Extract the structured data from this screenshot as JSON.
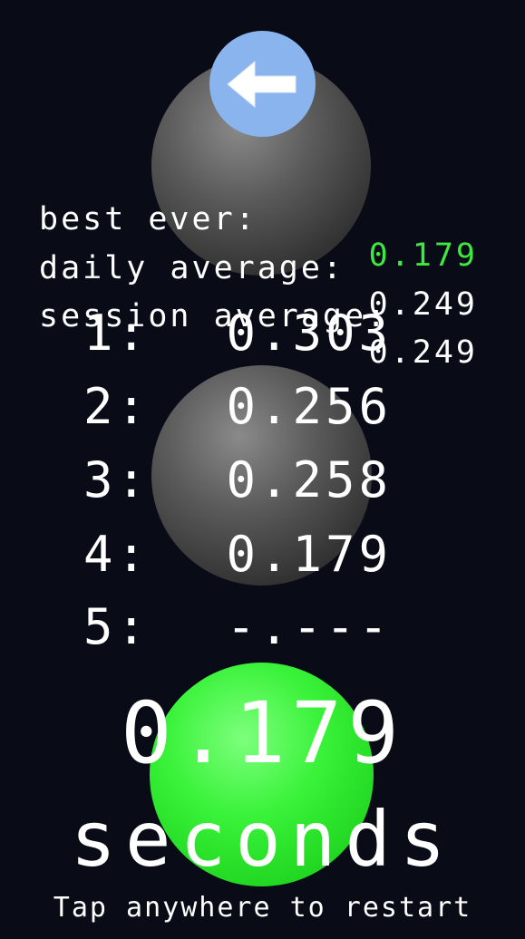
{
  "colors": {
    "background": "#090b16",
    "text": "#ffffff",
    "best_highlight": "#3ee83e",
    "back_button": "#8ab4ee",
    "result_ball": "#39f239",
    "idle_ball": "#5a5a5a"
  },
  "back_button": {
    "icon": "arrow-left-icon"
  },
  "stats": {
    "best_label": "best ever:",
    "best_value": "0.179",
    "daily_label": "daily average:",
    "daily_value": "0.249",
    "session_label": "session average:",
    "session_value": "0.249"
  },
  "attempts": [
    {
      "num": "1:",
      "time": "0.303"
    },
    {
      "num": "2:",
      "time": "0.256"
    },
    {
      "num": "3:",
      "time": "0.258"
    },
    {
      "num": "4:",
      "time": "0.179"
    },
    {
      "num": "5:",
      "time": "-.---"
    }
  ],
  "result": {
    "time": "0.179",
    "unit": "seconds"
  },
  "restart_hint": "Tap anywhere to restart"
}
